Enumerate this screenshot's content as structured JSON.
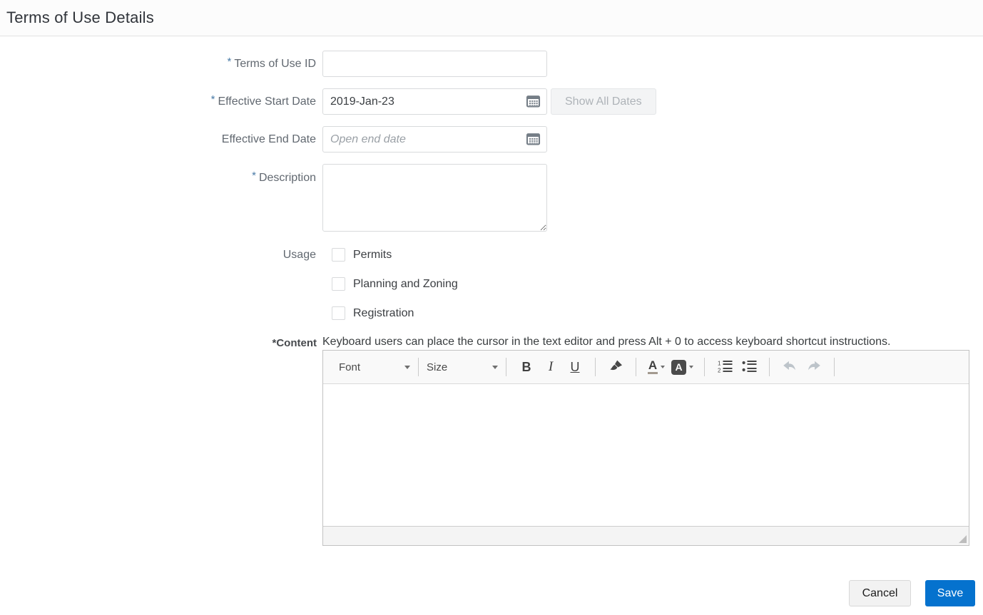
{
  "header": {
    "title": "Terms of Use Details"
  },
  "form": {
    "terms_id": {
      "label": "Terms of Use ID",
      "required": "*",
      "value": ""
    },
    "start_date": {
      "label": "Effective Start Date",
      "required": "*",
      "value": "2019-Jan-23"
    },
    "show_all_dates_label": "Show All Dates",
    "end_date": {
      "label": "Effective End Date",
      "placeholder": "Open end date"
    },
    "description": {
      "label": "Description",
      "required": "*",
      "value": ""
    },
    "usage": {
      "label": "Usage",
      "options": [
        {
          "label": "Permits",
          "checked": false
        },
        {
          "label": "Planning and Zoning",
          "checked": false
        },
        {
          "label": "Registration",
          "checked": false
        }
      ]
    },
    "content": {
      "label": "*Content",
      "hint": "Keyboard users can place the cursor in the text editor and press Alt + 0 to access keyboard shortcut instructions."
    }
  },
  "editor": {
    "font_dropdown_label": "Font",
    "size_dropdown_label": "Size",
    "bold_label": "B",
    "italic_label": "I",
    "underline_label": "U",
    "text_color_label": "A",
    "background_color_label": "A",
    "tools": [
      "font",
      "size",
      "bold",
      "italic",
      "underline",
      "paint-format",
      "text-color",
      "background-color",
      "ordered-list",
      "bullet-list",
      "undo",
      "redo"
    ],
    "content_value": ""
  },
  "actions": {
    "cancel": "Cancel",
    "save": "Save"
  },
  "colors": {
    "save_button": "#0572ce",
    "required_marker": "#4a7ba7",
    "header_title": "#30343a",
    "label_text": "#616870",
    "input_border": "#d8dadc",
    "toolbar_background": "#f9f9f9"
  }
}
